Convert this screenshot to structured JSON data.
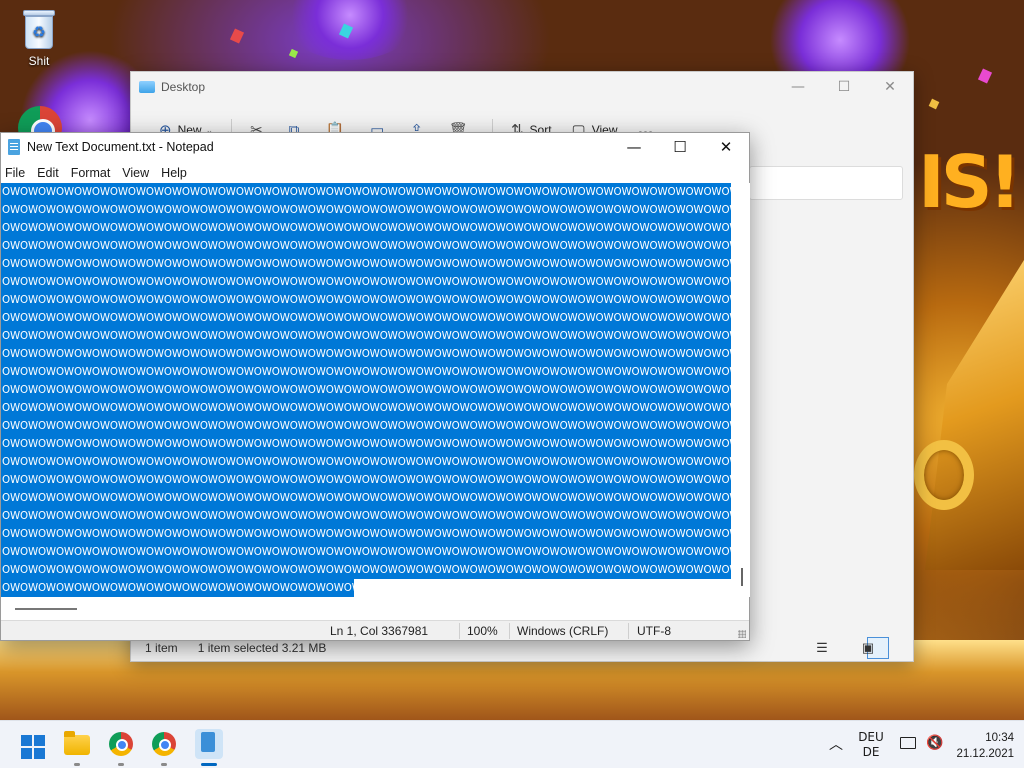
{
  "desktop": {
    "icons": [
      {
        "label": "Shit",
        "icon": "recycle-bin-icon"
      },
      {
        "label": "",
        "icon": "chrome-icon"
      }
    ]
  },
  "explorer": {
    "title": "Desktop",
    "toolbar": {
      "new_label": "New",
      "sort_label": "Sort",
      "view_label": "View",
      "more_label": "…"
    },
    "status": {
      "item_count": "1 item",
      "selection": "1 item selected  3.21 MB"
    }
  },
  "notepad": {
    "title": "New Text Document.txt - Notepad",
    "menu": [
      "File",
      "Edit",
      "Format",
      "View",
      "Help"
    ],
    "text_full_line": "OWOWOWOWOWOWOWOWOWOWOWOWOWOWOWOWOWOWOWOWOWOWOWOWOWOWOWOWOWOWOWOWOWOWOWOWOWOWOWOWOWOWOWOWOWOWOWOWOWOWOWOWOWOWOWOWOWOWOWOWOWOWOWOWOWOWOWOWOWOWOWOWOWOWOWOW",
    "text_last_line": "OWOWOWOWOWOWOWOWOWOWOWOWOWOWOWOWOWOWOWOWOWOWOWOWOWOWOWOWOWOWOWOWOWOWOWOWOWOW",
    "full_line_count": 22,
    "status": {
      "position": "Ln 1, Col 3367981",
      "zoom": "100%",
      "line_ending": "Windows (CRLF)",
      "encoding": "UTF-8"
    }
  },
  "taskbar": {
    "apps": [
      "start-icon",
      "file-explorer-icon",
      "chrome-icon",
      "chrome-icon",
      "notepad-icon"
    ],
    "language_top": "DEU",
    "language_bottom": "DE",
    "time": "10:34",
    "date": "21.12.2021"
  },
  "colors": {
    "selection": "#0078d7",
    "taskbar": "#f0f3f9",
    "accent": "#0067c0"
  }
}
